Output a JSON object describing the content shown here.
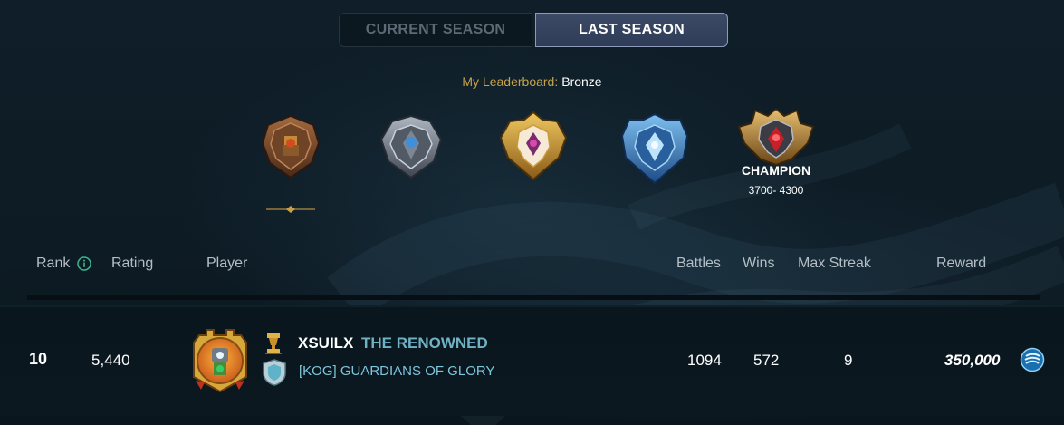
{
  "tabs": {
    "current": "CURRENT SEASON",
    "last": "LAST SEASON",
    "selected": "last"
  },
  "my_leaderboard": {
    "label": "My Leaderboard:",
    "value": "Bronze"
  },
  "leagues": {
    "items": [
      {
        "icon": "bronze-league-badge-icon"
      },
      {
        "icon": "silver-league-badge-icon"
      },
      {
        "icon": "gold-league-badge-icon"
      },
      {
        "icon": "diamond-league-badge-icon"
      },
      {
        "icon": "champion-league-badge-icon",
        "name": "CHAMPION",
        "range": "3700- 4300"
      }
    ]
  },
  "columns": {
    "rank": "Rank",
    "rating": "Rating",
    "player": "Player",
    "battles": "Battles",
    "wins": "Wins",
    "max_streak": "Max Streak",
    "reward": "Reward"
  },
  "row": {
    "rank": "10",
    "rating": "5,440",
    "player_name": "XSUILX",
    "player_title": "THE RENOWNED",
    "guild": "[KOG] GUARDIANS OF GLORY",
    "battles": "1094",
    "wins": "572",
    "max_streak": "9",
    "reward": "350,000",
    "reward_icon": "dec-token-icon"
  },
  "colors": {
    "gold_accent": "#c8a24a",
    "title_teal": "#6fb2c4",
    "guild_cyan": "#7ec6dc",
    "tab_active_bg": "#35435f"
  }
}
